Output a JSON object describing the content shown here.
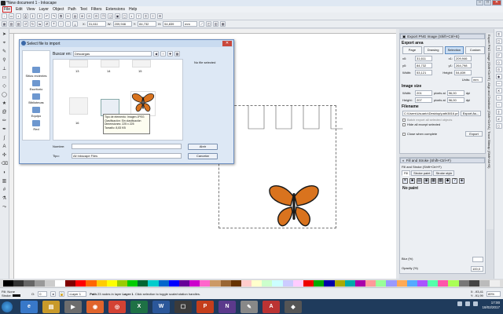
{
  "titlebar": {
    "title": "*New document 1 - Inkscape"
  },
  "menubar": {
    "items": [
      "File",
      "Edit",
      "View",
      "Layer",
      "Object",
      "Path",
      "Text",
      "Filters",
      "Extensions",
      "Help"
    ]
  },
  "toolcontrols": {
    "x_label": "X:",
    "x_value": "31,611",
    "y_label": "Y:",
    "y_value": "84,732",
    "w_label": "W:",
    "w_value": "209,946",
    "h_label": "H:",
    "h_value": "54,839",
    "units": "mm"
  },
  "export_panel": {
    "title": "Export PNG Image (Shift+Ctrl+E)",
    "export_area_label": "Export area",
    "buttons": [
      "Page",
      "Drawing",
      "Selection",
      "Custom"
    ],
    "selected_button": "Selection",
    "x0_label": "x0:",
    "x0_value": "31,611",
    "x1_label": "x1:",
    "x1_value": "209,946",
    "y0_label": "y0:",
    "y0_value": "84,732",
    "y1_label": "y1:",
    "y1_value": "264,798",
    "width_label": "Width:",
    "width_value": "53,121",
    "height_label": "Height:",
    "height_value": "54,839",
    "units_label": "Units:",
    "units_value": "mm",
    "image_size_label": "Image size",
    "img_width_label": "Width:",
    "img_width_value": "201",
    "img_height_label": "Height:",
    "img_height_value": "207",
    "dpi_value": "96,00",
    "pixels_at": "pixels at",
    "dpi_label": "dpi",
    "filename_label": "Filename",
    "filename_value": "C:\\Users\\Usuario\\Desktop\\path3816.png",
    "export_as_button": "Export As...",
    "batch_label": "Batch export all selected objects",
    "hide_label": "Hide all except selected",
    "close_when_complete": "Close when complete",
    "export_button": "Export"
  },
  "fill_panel": {
    "title": "Fill and Stroke (Shift+Ctrl+F)",
    "subheader": "Fill and Stroke (Shift+Ctrl+F)",
    "tabs": [
      "Fill",
      "Stroke paint",
      "Stroke style"
    ],
    "no_paint": "No paint",
    "blur_label": "Blur (%)",
    "opacity_label": "Opacity (%)",
    "opacity_value": "100,0"
  },
  "dialog": {
    "title": "Select file to import",
    "look_in_label": "Buscar en:",
    "look_in_value": "Descargas",
    "nav": [
      "Sitios recientes",
      "Escritorio",
      "Bibliotecas",
      "Equipo",
      "Red"
    ],
    "thumb_labels": [
      "13",
      "14",
      "15",
      "16",
      "17"
    ],
    "no_file_selected": "No file selected",
    "tooltip_lines": [
      "Tipo de elemento: Imagen JPEG",
      "Clasificación: Sin clasificación",
      "Dimensiones: 225 x 225",
      "Tamaño: 8,83 KB"
    ],
    "name_label": "Nombre:",
    "type_label": "Tipo:",
    "type_value": "All Inkscape Files",
    "open_button": "Abrir",
    "cancel_button": "Cancelar"
  },
  "statusbar": {
    "fill_label": "Fill:",
    "fill_value": "None",
    "stroke_label": "Stroke:",
    "o_label": "O:",
    "o_value": "0",
    "layer_value": "•Layer 1",
    "message_path": "Path",
    "message_rest": " 23 nodes in layer ",
    "message_layer": "Layer 1",
    "message_end": ". Click selection to toggle scale/rotation handles.",
    "x_coord": "X: -93,41",
    "y_coord": "Y: -91,99",
    "zoom": "89%"
  },
  "taskbar": {
    "time": "17:00",
    "date": "18/02/2017",
    "lang": "ES"
  },
  "colors": {
    "butterfly_orange": "#d9731e",
    "butterfly_black": "#1a1a1a",
    "taskbar_bg": "#1f3b5c",
    "selected_button": "#c8dcf2"
  }
}
